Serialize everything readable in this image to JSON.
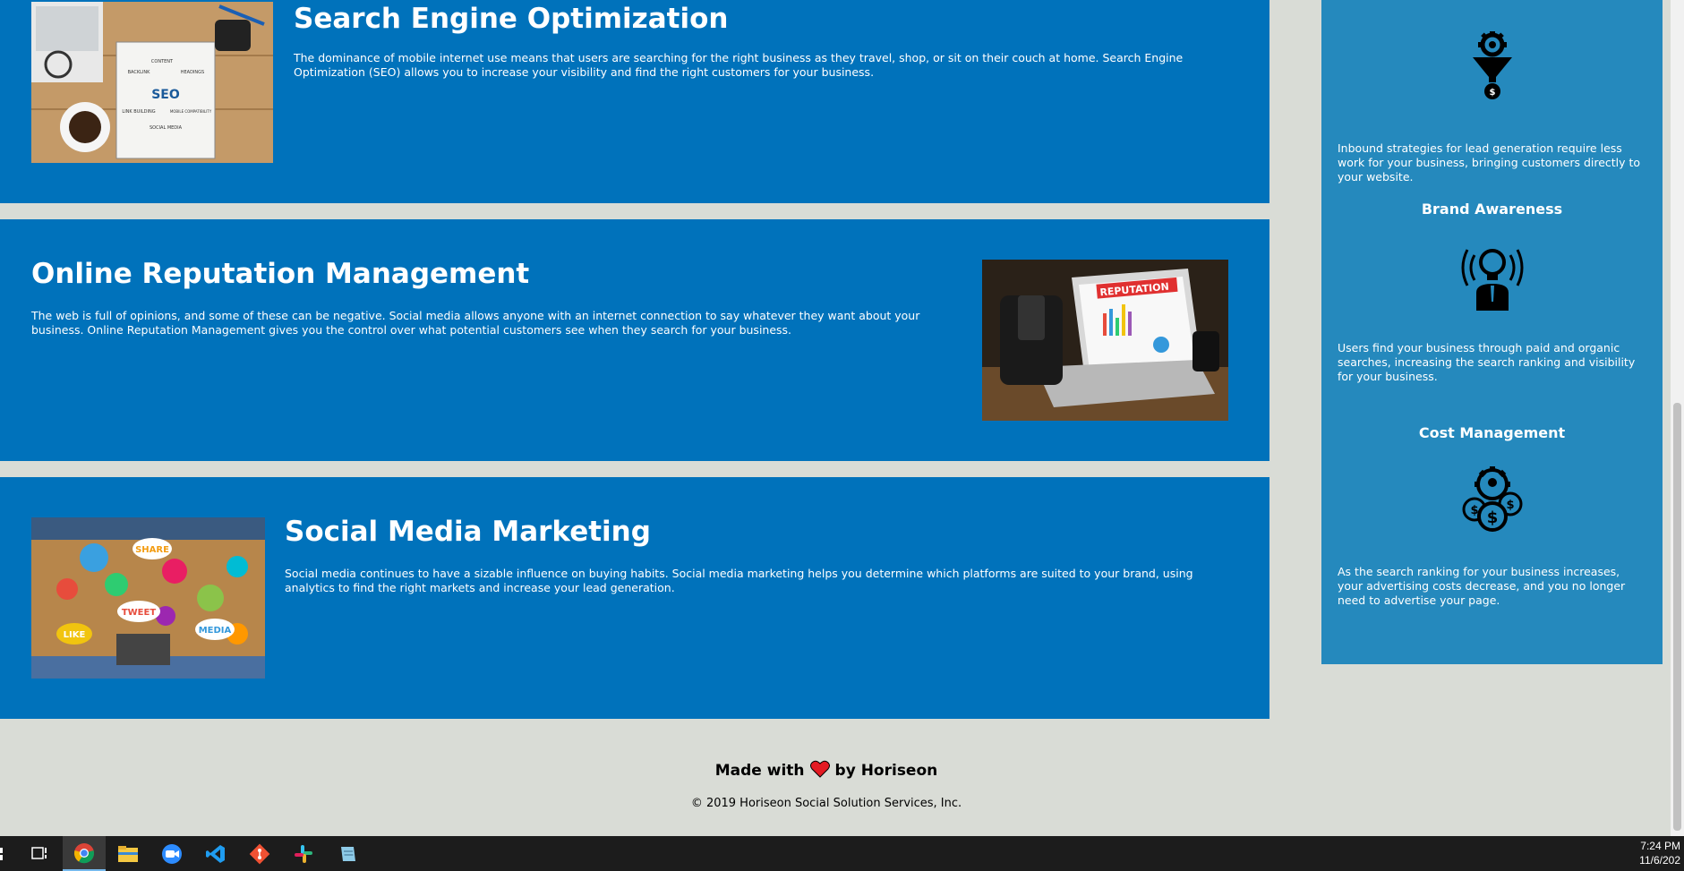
{
  "sections": [
    {
      "title": "Search Engine Optimization",
      "text": "The dominance of mobile internet use means that users are searching for the right business as they travel, shop, or sit on their couch at home. Search Engine Optimization (SEO) allows you to increase your visibility and find the right customers for your business.",
      "image_text": [
        "SEO",
        "CONTENT",
        "BACKLINK",
        "HEADINGS",
        "LINK BUILDING",
        "MOBILE COMPATIBILITY",
        "SOCIAL MEDIA"
      ]
    },
    {
      "title": "Online Reputation Management",
      "text": "The web is full of opinions, and some of these can be negative. Social media allows anyone with an internet connection to say whatever they want about your business. Online Reputation Management gives you the control over what potential customers see when they search for your business.",
      "image_text": "REPUTATION"
    },
    {
      "title": "Social Media Marketing",
      "text": "Social media continues to have a sizable influence on buying habits. Social media marketing helps you determine which platforms are suited to your brand, using analytics to find the right markets and increase your lead generation.",
      "image_text": [
        "SHARE",
        "TWEET",
        "LIKE",
        "MEDIA"
      ]
    }
  ],
  "benefits": [
    {
      "title": "",
      "text": "Inbound strategies for lead generation require less work for your business, bringing customers directly to your website.",
      "icon": "lead-funnel-icon"
    },
    {
      "title": "Brand Awareness",
      "text": "Users find your business through paid and organic searches, increasing the search ranking and visibility for your business.",
      "icon": "lightbulb-person-icon"
    },
    {
      "title": "Cost Management",
      "text": "As the search ranking for your business increases, your advertising costs decrease, and you no longer need to advertise your page.",
      "icon": "cost-gear-coins-icon"
    }
  ],
  "footer": {
    "made_with": "Made with",
    "by": "by Horiseon",
    "copyright": "© 2019 Horiseon Social Solution Services, Inc."
  },
  "taskbar": {
    "time": "7:24 PM",
    "date": "11/6/202",
    "apps": [
      "task-view-icon",
      "chrome-icon",
      "file-explorer-icon",
      "zoom-icon",
      "vscode-icon",
      "git-icon",
      "slack-icon",
      "notepad-icon"
    ]
  },
  "colors": {
    "section_bg": "#0072bb",
    "sidebar_bg": "#2589bd",
    "page_bg": "#d9dcd6",
    "taskbar_bg": "#1c1c1c"
  }
}
